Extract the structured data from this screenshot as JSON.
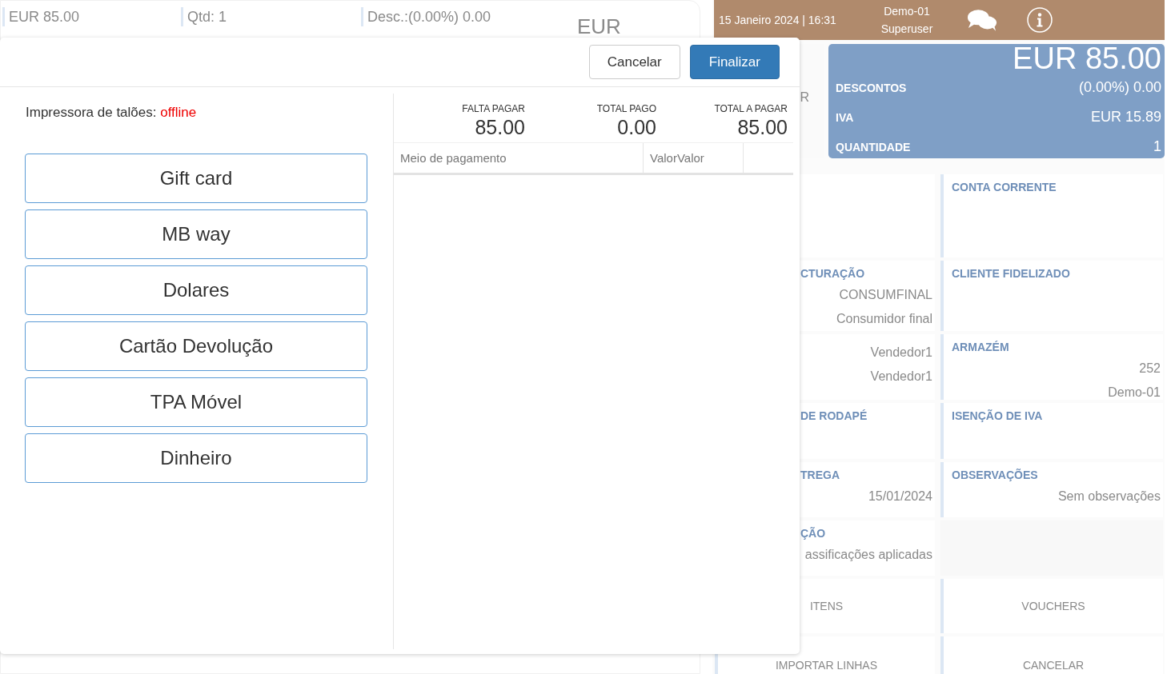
{
  "background": {
    "top_bar": {
      "total": "EUR 85.00",
      "quantity": "Qtd: 1",
      "discount": "Desc.:(0.00%) 0.00",
      "currency": "EUR"
    },
    "header": {
      "datetime": "15 Janeiro 2024 | 16:31",
      "store": "Demo-01",
      "user": "Superuser"
    },
    "side_card": {
      "text": "R"
    },
    "summary": {
      "total": "EUR 85.00",
      "rows": [
        {
          "label": "DESCONTOS",
          "value": "(0.00%) 0.00"
        },
        {
          "label": "IVA",
          "value": "EUR 15.89"
        },
        {
          "label": "QUANTIDADE",
          "value": "1"
        }
      ]
    },
    "cards": [
      {
        "kind": "info"
      },
      {
        "kind": "info",
        "title": "CONTA CORRENTE"
      },
      {
        "kind": "info",
        "title": "CTURAÇÃO",
        "values": [
          "CONSUMFINAL",
          "Consumidor final"
        ]
      },
      {
        "kind": "info",
        "title": "CLIENTE FIDELIZADO"
      },
      {
        "kind": "info",
        "values": [
          "Vendedor1",
          "Vendedor1"
        ]
      },
      {
        "kind": "info",
        "title": "ARMAZÉM",
        "values": [
          "252",
          "Demo-01"
        ]
      },
      {
        "kind": "info",
        "title": "DE RODAPÉ"
      },
      {
        "kind": "info",
        "title": "ISENÇÃO DE IVA"
      },
      {
        "kind": "info",
        "title": "TREGA",
        "values": [
          "15/01/2024"
        ]
      },
      {
        "kind": "info",
        "title": "OBSERVAÇÕES",
        "values": [
          "Sem observações"
        ]
      },
      {
        "kind": "info",
        "title": "ÇÃO",
        "values": [
          "assificações aplicadas"
        ]
      },
      {
        "kind": "blank"
      },
      {
        "kind": "action",
        "label": "ITENS"
      },
      {
        "kind": "action",
        "label": "VOUCHERS"
      },
      {
        "kind": "action",
        "label": "IMPORTAR LINHAS"
      },
      {
        "kind": "action",
        "label": "CANCELAR"
      }
    ]
  },
  "modal": {
    "buttons": [
      {
        "label": "Cancelar",
        "kind": "default"
      },
      {
        "label": "Finalizar",
        "kind": "primary"
      }
    ],
    "printer": {
      "label": "Impressora de talões:",
      "status": "offline"
    },
    "payment_methods": [
      "Gift card",
      "MB way",
      "Dolares",
      "Cartão Devolução",
      "TPA Móvel",
      "Dinheiro"
    ],
    "totals": [
      {
        "label": "FALTA PAGAR",
        "value": "85.00"
      },
      {
        "label": "TOTAL PAGO",
        "value": "0.00"
      },
      {
        "label": "TOTAL A PAGAR",
        "value": "85.00"
      }
    ],
    "table": {
      "columns": [
        "Meio de pagamento",
        "ValorValor"
      ]
    }
  }
}
